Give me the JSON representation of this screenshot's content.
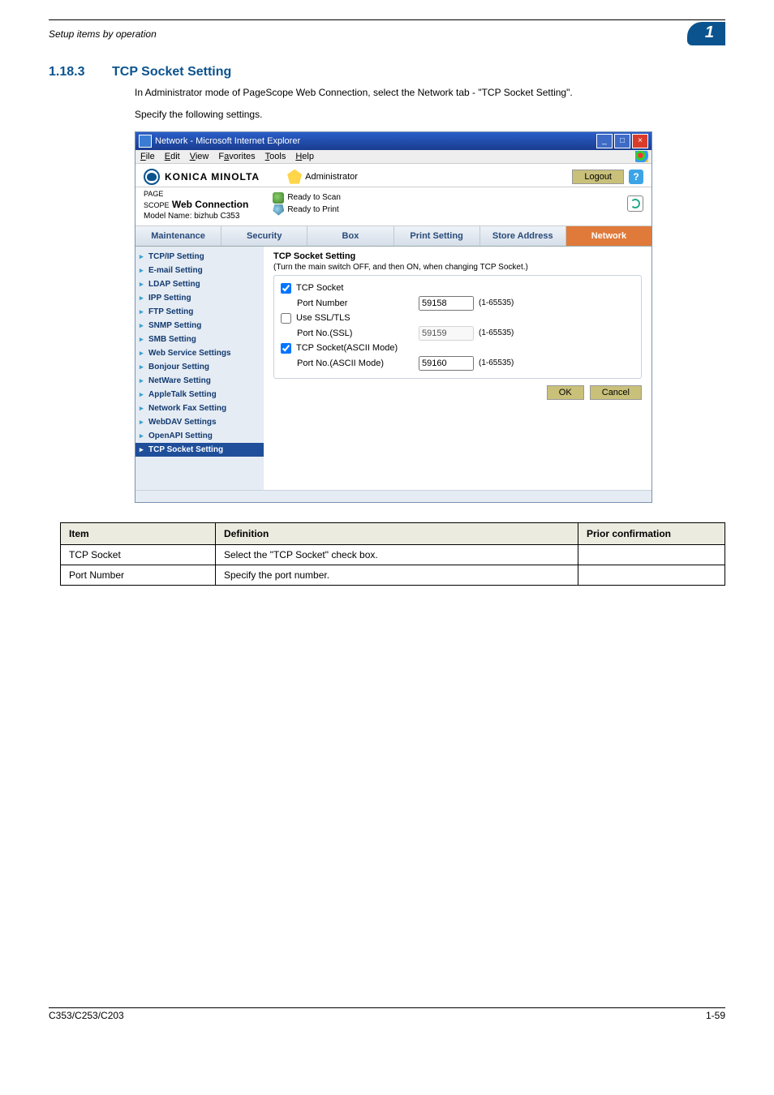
{
  "page": {
    "running_head": "Setup items by operation",
    "chapter_badge": "1",
    "section_number": "1.18.3",
    "section_title": "TCP Socket Setting",
    "para1": "In Administrator mode of PageScope Web Connection, select the Network tab - \"TCP Socket Setting\".",
    "para2": "Specify the following settings.",
    "footer_left": "C353/C253/C203",
    "footer_right": "1-59"
  },
  "screenshot": {
    "window_title": "Network - Microsoft Internet Explorer",
    "menus": {
      "file": "File",
      "edit": "Edit",
      "view": "View",
      "favorites": "Favorites",
      "tools": "Tools",
      "help": "Help"
    },
    "brand": "KONICA MINOLTA",
    "pagescope": "PAGE SCOPE Web Connection",
    "model": "Model Name: bizhub C353",
    "admin_label": "Administrator",
    "status_scan": "Ready to Scan",
    "status_print": "Ready to Print",
    "logout": "Logout",
    "help": "?",
    "tabs": [
      "Maintenance",
      "Security",
      "Box",
      "Print Setting",
      "Store Address",
      "Network"
    ],
    "active_tab_index": 5,
    "side_items": [
      "TCP/IP Setting",
      "E-mail Setting",
      "LDAP Setting",
      "IPP Setting",
      "FTP Setting",
      "SNMP Setting",
      "SMB Setting",
      "Web Service Settings",
      "Bonjour Setting",
      "NetWare Setting",
      "AppleTalk Setting",
      "Network Fax Setting",
      "WebDAV Settings",
      "OpenAPI Setting",
      "TCP Socket Setting"
    ],
    "selected_side_index": 14,
    "panel": {
      "heading": "TCP Socket Setting",
      "note": "(Turn the main switch OFF, and then ON, when changing TCP Socket.)",
      "tcp_socket_label": "TCP Socket",
      "tcp_socket_checked": true,
      "port_number_label": "Port Number",
      "port_number_value": "59158",
      "port_range": "(1-65535)",
      "use_ssl_label": "Use SSL/TLS",
      "use_ssl_checked": false,
      "port_ssl_label": "Port No.(SSL)",
      "port_ssl_value": "59159",
      "port_ssl_range": "(1-65535)",
      "tcp_ascii_label": "TCP Socket(ASCII Mode)",
      "tcp_ascii_checked": true,
      "port_ascii_label": "Port No.(ASCII Mode)",
      "port_ascii_value": "59160",
      "port_ascii_range": "(1-65535)",
      "ok": "OK",
      "cancel": "Cancel"
    }
  },
  "table": {
    "headers": [
      "Item",
      "Definition",
      "Prior confirmation"
    ],
    "rows": [
      {
        "item": "TCP Socket",
        "definition": "Select the \"TCP Socket\" check box.",
        "prior": ""
      },
      {
        "item": "Port Number",
        "definition": "Specify the port number.",
        "prior": ""
      }
    ]
  }
}
